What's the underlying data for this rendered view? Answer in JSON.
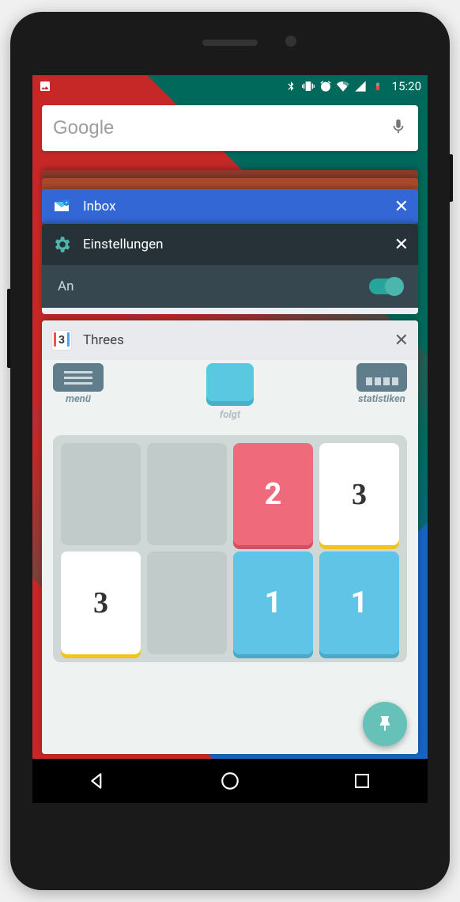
{
  "status": {
    "time": "15:20"
  },
  "search": {
    "placeholder": "Google"
  },
  "cards": {
    "inbox": {
      "title": "Inbox"
    },
    "settings": {
      "title": "Einstellungen",
      "toggle_label": "An"
    },
    "threes": {
      "title": "Threes",
      "menu_label": "menü",
      "next_label": "folgt",
      "stats_label": "statistiken",
      "board": [
        [
          "",
          "",
          "2",
          "3"
        ],
        [
          "3",
          "",
          "1",
          "1"
        ]
      ]
    }
  }
}
